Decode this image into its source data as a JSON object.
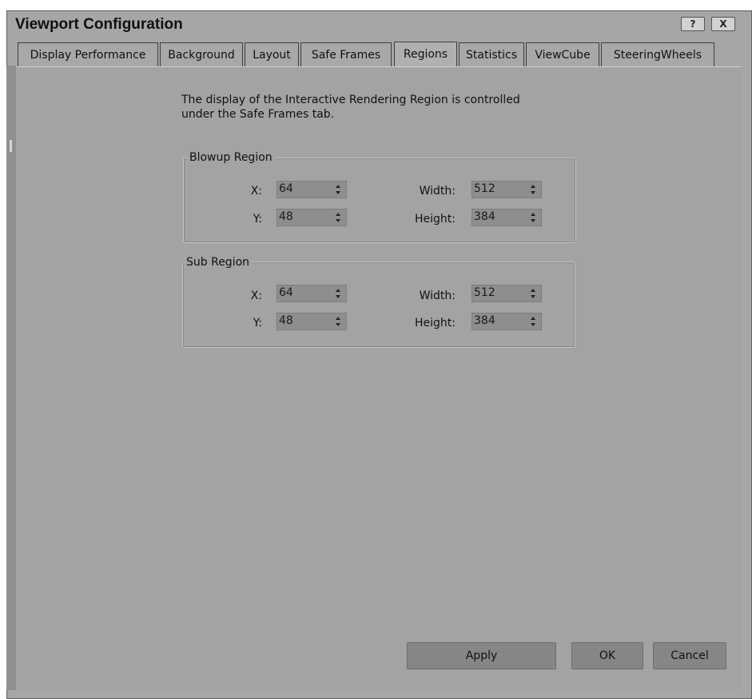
{
  "window": {
    "title": "Viewport Configuration",
    "help_label": "?",
    "close_label": "X"
  },
  "tabs": [
    {
      "label": "Display Performance"
    },
    {
      "label": "Background"
    },
    {
      "label": "Layout"
    },
    {
      "label": "Safe Frames"
    },
    {
      "label": "Regions",
      "active": true
    },
    {
      "label": "Statistics"
    },
    {
      "label": "ViewCube"
    },
    {
      "label": "SteeringWheels"
    }
  ],
  "regions": {
    "description_line1": "The display of the Interactive Rendering Region is controlled",
    "description_line2": "under the Safe Frames tab.",
    "blowup": {
      "title": "Blowup Region",
      "x_label": "X:",
      "x": "64",
      "y_label": "Y:",
      "y": "48",
      "width_label": "Width:",
      "width": "512",
      "height_label": "Height:",
      "height": "384"
    },
    "sub": {
      "title": "Sub Region",
      "x_label": "X:",
      "x": "64",
      "y_label": "Y:",
      "y": "48",
      "width_label": "Width:",
      "width": "512",
      "height_label": "Height:",
      "height": "384"
    }
  },
  "buttons": {
    "apply": "Apply",
    "ok": "OK",
    "cancel": "Cancel"
  }
}
